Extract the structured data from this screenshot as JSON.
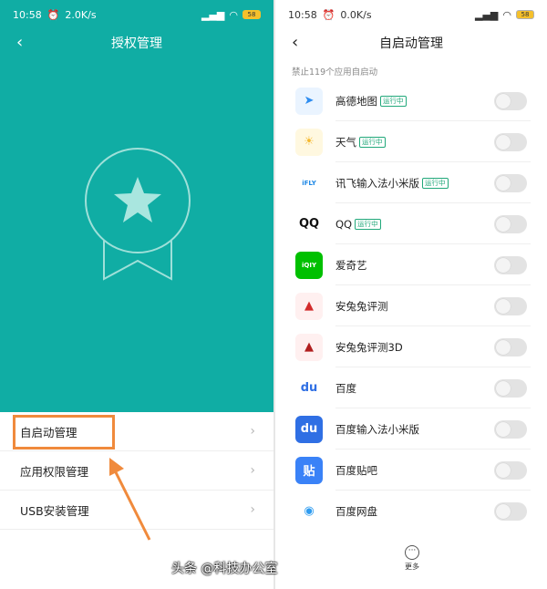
{
  "left": {
    "status": {
      "time": "10:58",
      "speed": "2.0K/s",
      "battery": "58"
    },
    "title": "授权管理",
    "back_icon": "chevron-left-icon",
    "menu": [
      {
        "label": "自启动管理"
      },
      {
        "label": "应用权限管理"
      },
      {
        "label": "USB安装管理"
      }
    ]
  },
  "right": {
    "status": {
      "time": "10:58",
      "speed": "0.0K/s",
      "battery": "58"
    },
    "title": "自启动管理",
    "subtitle": "禁止119个应用自启动",
    "running_tag": "运行中",
    "apps": [
      {
        "name": "高德地图",
        "running": true,
        "icon": "gaode-map-icon"
      },
      {
        "name": "天气",
        "running": true,
        "icon": "weather-icon"
      },
      {
        "name": "讯飞输入法小米版",
        "running": true,
        "icon": "ifly-icon"
      },
      {
        "name": "QQ",
        "running": true,
        "icon": "qq-icon"
      },
      {
        "name": "爱奇艺",
        "running": false,
        "icon": "iqiyi-icon"
      },
      {
        "name": "安兔兔评测",
        "running": false,
        "icon": "antutu-icon"
      },
      {
        "name": "安兔兔评测3D",
        "running": false,
        "icon": "antutu-3d-icon"
      },
      {
        "name": "百度",
        "running": false,
        "icon": "baidu-icon"
      },
      {
        "name": "百度输入法小米版",
        "running": false,
        "icon": "baidu-input-icon"
      },
      {
        "name": "百度贴吧",
        "running": false,
        "icon": "baidu-tieba-icon"
      },
      {
        "name": "百度网盘",
        "running": false,
        "icon": "baidu-netdisk-icon"
      }
    ],
    "more_label": "更多"
  },
  "watermark": "头条 @科技办公室",
  "colors": {
    "teal": "#10ada4",
    "highlight": "#f08a3c",
    "running_tag": "#21a87a"
  }
}
